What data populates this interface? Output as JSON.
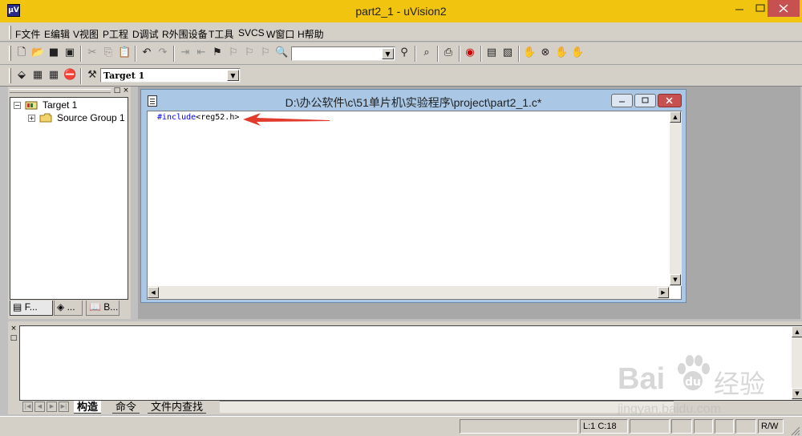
{
  "window": {
    "title": "part2_1  - uVision2",
    "icon": "uv2-app-icon"
  },
  "menu": [
    {
      "label": "F文件"
    },
    {
      "label": "E编辑"
    },
    {
      "label": "V视图"
    },
    {
      "label": "P工程"
    },
    {
      "label": "D调试"
    },
    {
      "label": "R外围设备"
    },
    {
      "label": "T工具"
    },
    {
      "label": "SVCS"
    },
    {
      "label": "W窗口"
    },
    {
      "label": "H帮助"
    }
  ],
  "toolbar1": {
    "icons": [
      "new-file-icon",
      "open-file-icon",
      "save-icon",
      "save-all-icon",
      "cut-icon",
      "copy-icon",
      "paste-icon",
      "undo-icon",
      "redo-icon",
      "indent-icon",
      "unindent-icon",
      "bookmark-toggle-icon",
      "bookmark-next-icon",
      "bookmark-prev-icon",
      "bookmark-clear-icon",
      "find-in-files-icon",
      "search-icon",
      "find-icon",
      "print-icon",
      "debug-icon",
      "window-icon",
      "browse-icon",
      "breakpoint-icon",
      "kill-breakpoint-icon",
      "enable-breakpoint-icon",
      "disable-breakpoint-icon"
    ],
    "find_combo_value": ""
  },
  "toolbar2": {
    "icons": [
      "translate-icon",
      "build-icon",
      "rebuild-icon",
      "stop-build-icon",
      "target-options-icon"
    ],
    "target_select": "Target 1"
  },
  "project": {
    "tree": [
      {
        "label": "Target 1",
        "toggle": "−",
        "icon": "target-icon"
      },
      {
        "label": "Source Group 1",
        "toggle": "+",
        "icon": "folder-icon"
      }
    ],
    "tabs": [
      {
        "label": "F..."
      },
      {
        "label": "..."
      },
      {
        "label": "B..."
      }
    ]
  },
  "editor": {
    "title": "D:\\办公软件\\c\\51单片机\\实验程序\\project\\part2_1.c*",
    "code": {
      "keyword": "#include",
      "rest": "<reg52.h>"
    }
  },
  "output": {
    "tabs": [
      {
        "label": "构造"
      },
      {
        "label": "命令"
      },
      {
        "label": "文件内查找"
      }
    ]
  },
  "status": {
    "cells": [
      "",
      "",
      "L:1 C:18",
      "",
      "",
      "",
      "",
      "R/W"
    ]
  },
  "watermark": {
    "brand": "Bai",
    "brand_cn": "经验",
    "url": "jingyan.baidu.com"
  },
  "colors": {
    "titlebar": "#f1c40f",
    "close_red": "#c75050",
    "arrow_red": "#e23b2e",
    "keyword_blue": "#0000ff"
  }
}
